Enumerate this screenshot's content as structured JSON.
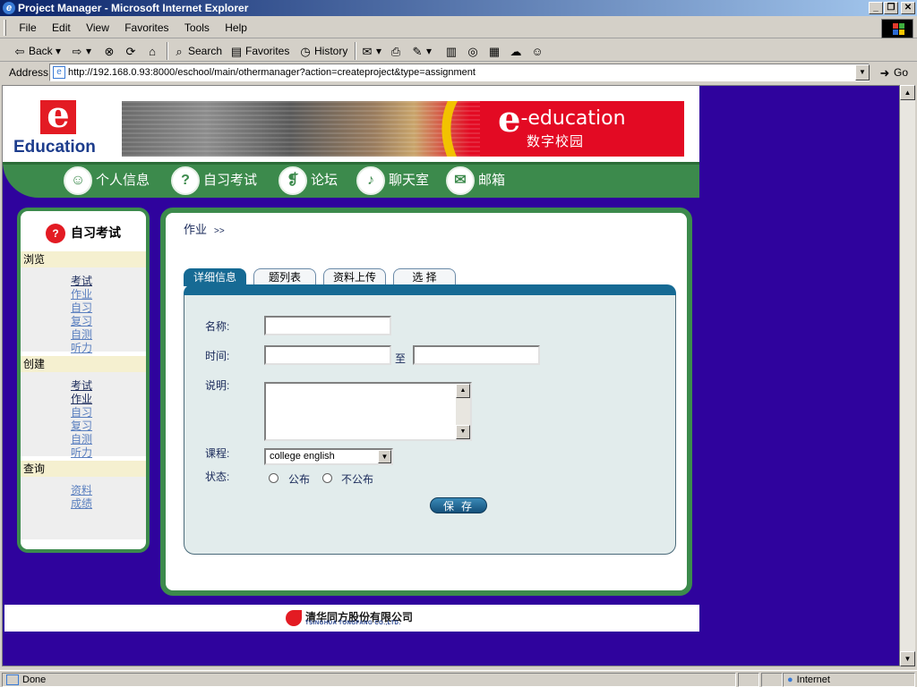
{
  "window": {
    "title": "Project Manager - Microsoft Internet Explorer",
    "icon": "ie-icon"
  },
  "menu": [
    "File",
    "Edit",
    "View",
    "Favorites",
    "Tools",
    "Help"
  ],
  "toolbar": {
    "back": "Back",
    "search": "Search",
    "favorites": "Favorites",
    "history": "History"
  },
  "address": {
    "label": "Address",
    "url": "http://192.168.0.93:8000/eschool/main/othermanager?action=createproject&type=assignment",
    "go": "Go"
  },
  "header": {
    "logo_text": "Education",
    "banner_brand": "-education",
    "banner_brand_e": "e",
    "banner_sub": "数字校园"
  },
  "nav": [
    {
      "label": "个人信息",
      "icon": "person-icon"
    },
    {
      "label": "自习考试",
      "icon": "question-icon"
    },
    {
      "label": "论坛",
      "icon": "forum-icon"
    },
    {
      "label": "聊天室",
      "icon": "mic-icon"
    },
    {
      "label": "邮箱",
      "icon": "mail-icon"
    }
  ],
  "sidebar": {
    "title": "自习考试",
    "sections": [
      {
        "label": "浏览",
        "links": [
          "考试",
          "作业",
          "自习",
          "复习",
          "自测",
          "听力"
        ]
      },
      {
        "label": "创建",
        "links": [
          "考试",
          "作业",
          "自习",
          "复习",
          "自测",
          "听力"
        ]
      },
      {
        "label": "查询",
        "links": [
          "资料",
          "成绩"
        ]
      }
    ]
  },
  "main": {
    "breadcrumb": "作业",
    "breadcrumb_sep": ">>",
    "tabs": [
      "详细信息",
      "题列表",
      "资料上传",
      "选 择"
    ],
    "form": {
      "name_label": "名称:",
      "time_label": "时间:",
      "time_to": "至",
      "desc_label": "说明:",
      "course_label": "课程:",
      "course_value": "college english",
      "status_label": "状态:",
      "status_options": [
        "公布",
        "不公布"
      ],
      "save": "保存"
    }
  },
  "footer": {
    "company_cn": "清华同方股份有限公司",
    "company_en": "TSINGHUA TONGFANG CO.,LTD."
  },
  "status": {
    "left": "Done",
    "zone": "Internet"
  },
  "colors": {
    "nav_green": "#3c8a4c",
    "page_bg": "#2f039d",
    "tab_blue": "#166a94",
    "brand_red": "#e31b23"
  }
}
